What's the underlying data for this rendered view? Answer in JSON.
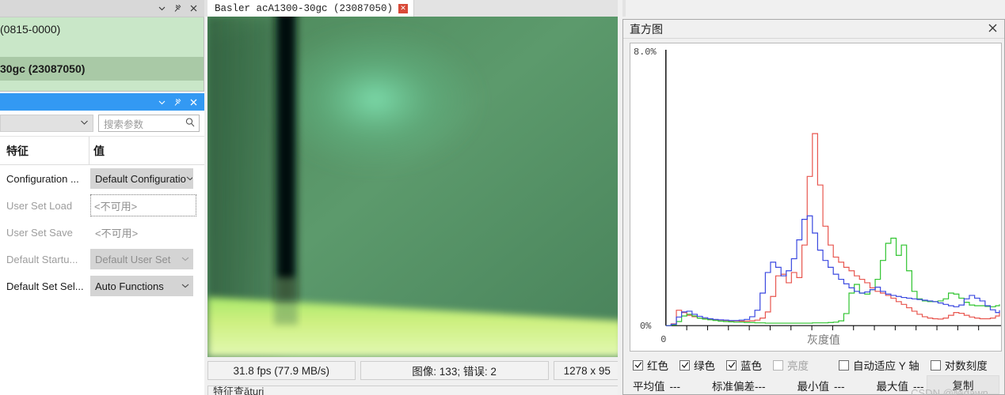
{
  "left_panel": {
    "window_controls": {
      "collapse": "chevron-down-icon",
      "pin": "pin-icon",
      "close": "close-icon"
    },
    "device_tree": [
      {
        "label": "(0815-0000)",
        "selected": false
      },
      {
        "label": "30gc (23087050)",
        "selected": true
      }
    ],
    "params": {
      "filter_combo_value": "",
      "search_placeholder": "搜索参数",
      "search_icon": "search-icon",
      "columns": {
        "feature": "特征",
        "value": "值"
      },
      "rows": [
        {
          "name": "Configuration ...",
          "value": "Default Configuratio",
          "kind": "combo",
          "disabled": false
        },
        {
          "name": "User Set Load",
          "value": "<不可用>",
          "kind": "dotted",
          "disabled": true
        },
        {
          "name": "User Set Save",
          "value": "<不可用>",
          "kind": "plain",
          "disabled": true
        },
        {
          "name": "Default Startu...",
          "value": "Default User Set",
          "kind": "combo-dim",
          "disabled": true
        },
        {
          "name": "Default Set Sel...",
          "value": "Auto Functions",
          "kind": "combo",
          "disabled": false
        }
      ]
    }
  },
  "camera": {
    "tab_title": "Basler acA1300-30gc (23087050)",
    "tab_close_icon": "close-icon",
    "status": {
      "fps": "31.8 fps (77.9 MB/s)",
      "images": "图像: 133; 错误: 2",
      "resolution": "1278 x 95"
    },
    "bottom_text": "特征查ături"
  },
  "histogram": {
    "title": "直方图",
    "close_icon": "close-icon",
    "y_max_label": "8.0%",
    "y_min_label": "0%",
    "x_origin_label": "0",
    "x_axis_label": "灰度值",
    "channels": [
      {
        "label": "红色",
        "checked": true,
        "enabled": true,
        "color": "#e03030"
      },
      {
        "label": "绿色",
        "checked": true,
        "enabled": true,
        "color": "#1fbb1f"
      },
      {
        "label": "蓝色",
        "checked": true,
        "enabled": true,
        "color": "#3333dd"
      },
      {
        "label": "亮度",
        "checked": false,
        "enabled": false,
        "color": "#888888"
      }
    ],
    "options": [
      {
        "label": "自动适应 Y 轴",
        "checked": false
      },
      {
        "label": "对数刻度",
        "checked": false
      }
    ],
    "stats": [
      {
        "label": "平均值",
        "value": "---"
      },
      {
        "label": "标准偏差",
        "value": "---"
      },
      {
        "label": "最小值",
        "value": "---"
      },
      {
        "label": "最大值",
        "value": "---"
      }
    ],
    "copy_button": "复制",
    "watermark": "CSDN @晓dawn"
  },
  "chart_data": {
    "type": "line",
    "title": "直方图",
    "xlabel": "灰度值",
    "ylabel": "",
    "xlim": [
      0,
      255
    ],
    "ylim": [
      0,
      8
    ],
    "ytick_labels": [
      "0%",
      "8.0%"
    ],
    "xtick_labels": [
      "0"
    ],
    "grid": false,
    "legend": [
      "红色",
      "绿色",
      "蓝色"
    ],
    "legend_position": "below-plot",
    "x": [
      0,
      4,
      8,
      12,
      16,
      20,
      24,
      28,
      32,
      36,
      40,
      44,
      48,
      52,
      56,
      60,
      64,
      68,
      72,
      76,
      80,
      84,
      88,
      92,
      96,
      100,
      104,
      108,
      112,
      116,
      120,
      124,
      128,
      132,
      136,
      140,
      144,
      148,
      152,
      156,
      160,
      164,
      168,
      172,
      176,
      180,
      184,
      188,
      192,
      196,
      200,
      204,
      208,
      212,
      216,
      220,
      224,
      228,
      232,
      236,
      240,
      244,
      248,
      252,
      255
    ],
    "series": [
      {
        "name": "红色",
        "color": "#e8554e",
        "values": [
          0.0,
          0.05,
          0.45,
          0.38,
          0.3,
          0.26,
          0.22,
          0.2,
          0.18,
          0.17,
          0.16,
          0.15,
          0.14,
          0.14,
          0.13,
          0.13,
          0.14,
          0.16,
          0.22,
          0.4,
          0.85,
          1.45,
          1.5,
          1.25,
          1.55,
          1.4,
          2.35,
          4.35,
          5.6,
          4.1,
          2.9,
          2.35,
          2.0,
          1.85,
          1.7,
          1.6,
          1.45,
          1.35,
          1.25,
          1.1,
          1.0,
          0.95,
          0.88,
          0.8,
          0.7,
          0.62,
          0.52,
          0.42,
          0.33,
          0.26,
          0.22,
          0.2,
          0.19,
          0.22,
          0.3,
          0.38,
          0.36,
          0.3,
          0.25,
          0.22,
          0.2,
          0.2,
          0.22,
          0.28,
          0.38
        ]
      },
      {
        "name": "绿色",
        "color": "#2fc42f",
        "values": [
          0.0,
          0.02,
          0.12,
          0.28,
          0.33,
          0.28,
          0.22,
          0.19,
          0.17,
          0.15,
          0.13,
          0.12,
          0.11,
          0.1,
          0.1,
          0.09,
          0.09,
          0.08,
          0.08,
          0.07,
          0.07,
          0.07,
          0.07,
          0.07,
          0.07,
          0.07,
          0.07,
          0.07,
          0.08,
          0.08,
          0.08,
          0.09,
          0.1,
          0.14,
          0.35,
          0.95,
          1.2,
          0.95,
          0.92,
          1.05,
          1.35,
          1.9,
          2.4,
          2.55,
          2.05,
          2.35,
          1.6,
          1.0,
          0.78,
          0.72,
          0.7,
          0.7,
          0.72,
          0.78,
          0.95,
          0.92,
          0.8,
          0.68,
          0.6,
          0.58,
          0.58,
          0.56,
          0.55,
          0.58,
          0.62
        ]
      },
      {
        "name": "蓝色",
        "color": "#3a48e0",
        "values": [
          0.0,
          0.04,
          0.25,
          0.4,
          0.42,
          0.33,
          0.27,
          0.23,
          0.2,
          0.18,
          0.17,
          0.16,
          0.15,
          0.15,
          0.16,
          0.18,
          0.26,
          0.45,
          0.95,
          1.55,
          1.85,
          1.7,
          1.45,
          1.6,
          1.95,
          2.5,
          3.1,
          3.2,
          2.7,
          2.2,
          1.9,
          1.7,
          1.5,
          1.35,
          1.22,
          1.1,
          1.0,
          0.95,
          0.98,
          1.05,
          1.12,
          1.0,
          0.92,
          0.88,
          0.85,
          0.82,
          0.8,
          0.78,
          0.76,
          0.74,
          0.72,
          0.7,
          0.66,
          0.62,
          0.58,
          0.55,
          0.6,
          0.78,
          0.88,
          0.8,
          0.72,
          0.58,
          0.46,
          0.38,
          0.45
        ]
      }
    ]
  }
}
